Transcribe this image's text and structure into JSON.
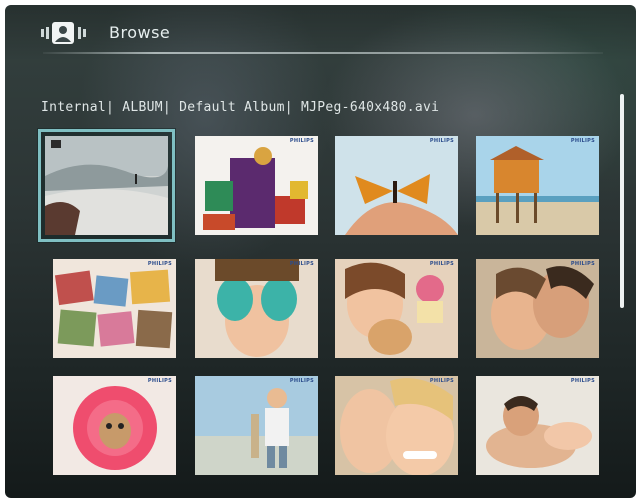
{
  "header": {
    "title": "Browse",
    "mode_icon": "person-browse-icon"
  },
  "breadcrumb": "Internal| ALBUM| Default Album| MJPeg-640x480.avi",
  "thumbnails": [
    {
      "subject": "snowy landscape with figure",
      "selected": true,
      "brand": ""
    },
    {
      "subject": "gift boxes with bow",
      "selected": false,
      "brand": "PHILIPS"
    },
    {
      "subject": "butterfly on hand",
      "selected": false,
      "brand": "PHILIPS"
    },
    {
      "subject": "beach hut on stilts",
      "selected": false,
      "brand": "PHILIPS"
    },
    {
      "subject": "photo collage",
      "selected": false,
      "brand": "PHILIPS"
    },
    {
      "subject": "child with painted hands",
      "selected": false,
      "brand": "PHILIPS"
    },
    {
      "subject": "woman with puppy and cupcake",
      "selected": false,
      "brand": "PHILIPS"
    },
    {
      "subject": "couple embracing",
      "selected": false,
      "brand": "PHILIPS"
    },
    {
      "subject": "dog in flower costume",
      "selected": false,
      "brand": "PHILIPS"
    },
    {
      "subject": "boy holding fish",
      "selected": false,
      "brand": "PHILIPS"
    },
    {
      "subject": "smiling couple close-up",
      "selected": false,
      "brand": "PHILIPS"
    },
    {
      "subject": "couple at the beach",
      "selected": false,
      "brand": "PHILIPS"
    }
  ],
  "colors": {
    "selection": "#7fbfc2",
    "text": "#e6eeee"
  }
}
